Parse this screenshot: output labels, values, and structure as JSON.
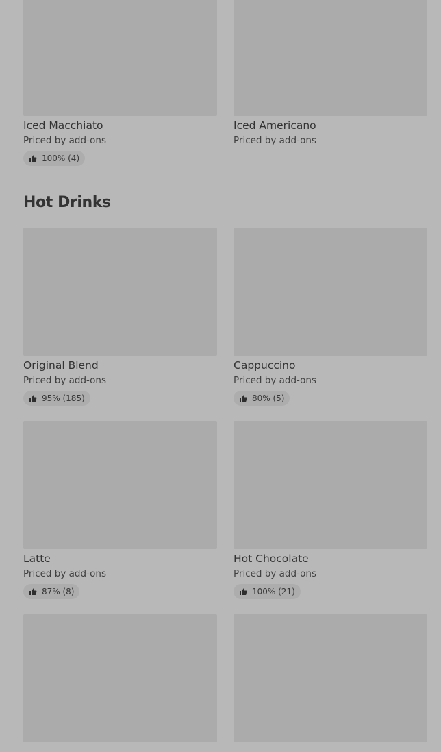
{
  "iced_items": [
    {
      "name": "Iced Macchiato",
      "price": "Priced by add-ons",
      "rating": "100% (4)"
    },
    {
      "name": "Iced Americano",
      "price": "Priced by add-ons",
      "rating": null
    }
  ],
  "hot_drinks": {
    "title": "Hot Drinks",
    "items": [
      {
        "name": "Original Blend",
        "price": "Priced by add-ons",
        "rating": "95% (185)"
      },
      {
        "name": "Cappuccino",
        "price": "Priced by add-ons",
        "rating": "80% (5)"
      },
      {
        "name": "Latte",
        "price": "Priced by add-ons",
        "rating": "87% (8)"
      },
      {
        "name": "Hot Chocolate",
        "price": "Priced by add-ons",
        "rating": "100% (21)"
      },
      {
        "name": "",
        "price": "",
        "rating": null
      },
      {
        "name": "",
        "price": "",
        "rating": null
      }
    ]
  },
  "icons": {
    "rating": "thumbs-up-icon"
  }
}
